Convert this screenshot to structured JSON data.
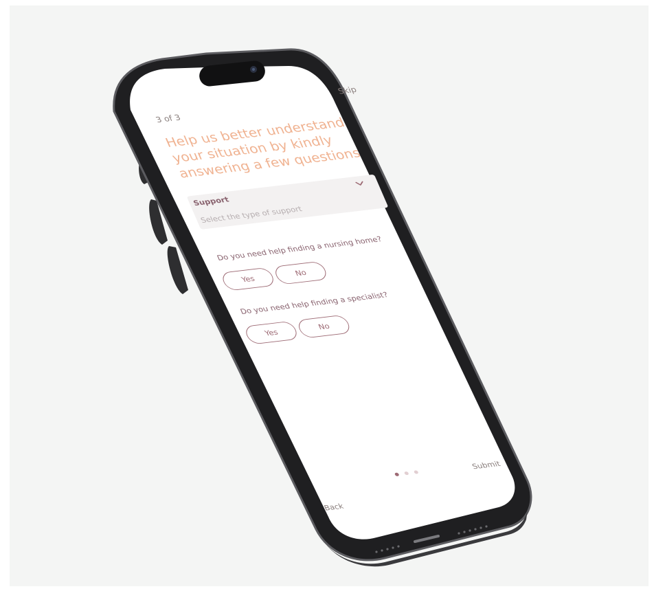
{
  "colors": {
    "backdrop": "#f4f5f4",
    "title_accent": "#f0b392",
    "brand": "#9d6a74",
    "muted_text": "#8a7f7d",
    "device_frame": "#2b2b2d"
  },
  "header": {
    "step_label": "3 of 3",
    "skip_label": "Skip"
  },
  "title": "Help us better understand your situation by kindly answering a few questions",
  "support_field": {
    "label": "Support",
    "placeholder": "Select the type of support",
    "icon": "chevron-down-icon"
  },
  "questions": [
    {
      "text": "Do you need help finding a nursing home?",
      "options": [
        "Yes",
        "No"
      ]
    },
    {
      "text": "Do you need help finding a specialist?",
      "options": [
        "Yes",
        "No"
      ]
    }
  ],
  "pagination": {
    "total": 3,
    "active_index": 0
  },
  "footer": {
    "back_label": "Back",
    "submit_label": "Submit"
  }
}
